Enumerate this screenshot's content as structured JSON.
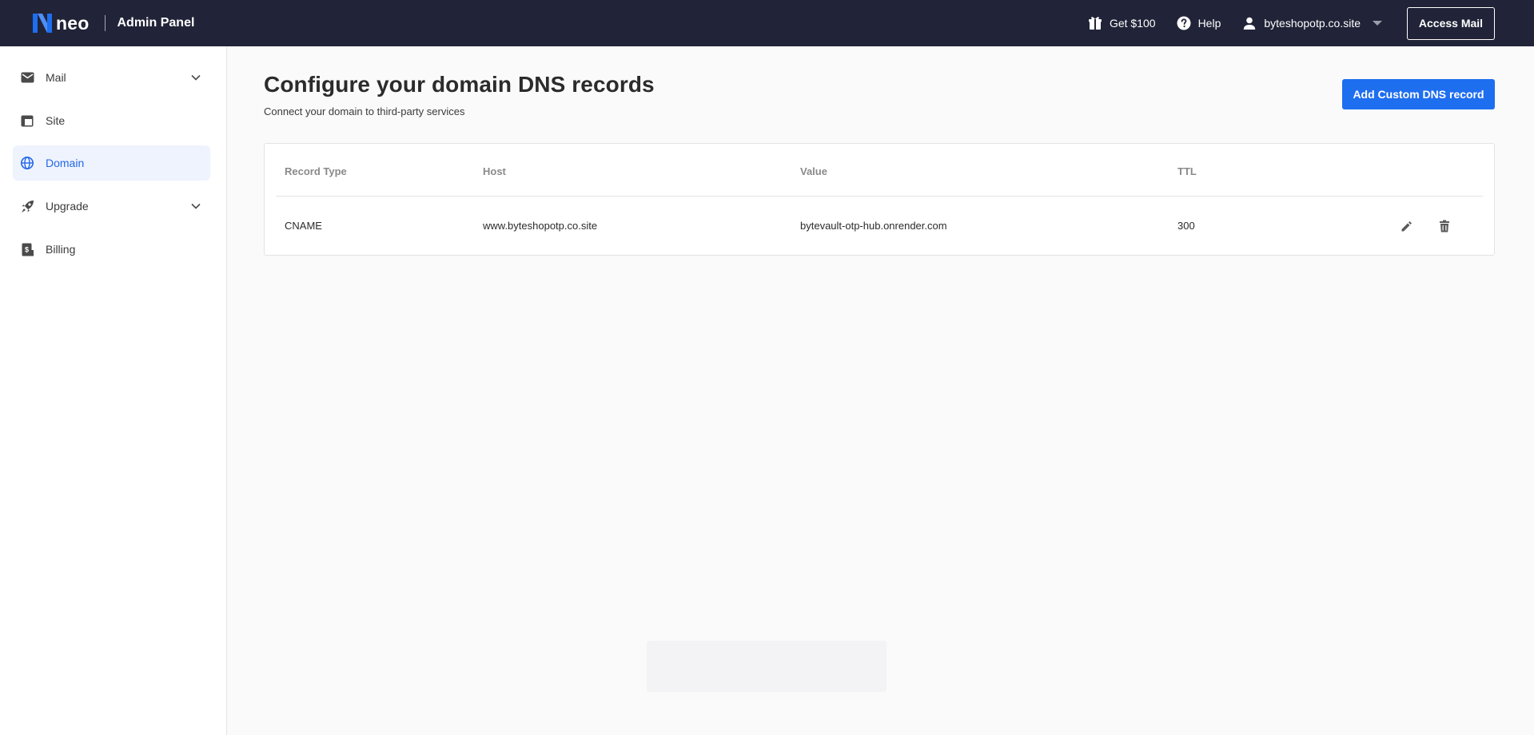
{
  "header": {
    "logo_text": "neo",
    "title": "Admin Panel",
    "gift_label": "Get $100",
    "help_label": "Help",
    "account_label": "byteshopotp.co.site",
    "access_mail_label": "Access Mail",
    "colors": {
      "bar_bg": "#212338",
      "logo_blue": "#1e6ef0"
    },
    "icons": [
      "gift-icon",
      "help-icon",
      "user-icon",
      "caret-down-icon"
    ]
  },
  "sidebar": {
    "items": [
      {
        "label": "Mail",
        "icon": "mail-icon",
        "has_chevron": true,
        "active": false
      },
      {
        "label": "Site",
        "icon": "site-icon",
        "has_chevron": false,
        "active": false
      },
      {
        "label": "Domain",
        "icon": "globe-icon",
        "has_chevron": false,
        "active": true
      },
      {
        "label": "Upgrade",
        "icon": "rocket-icon",
        "has_chevron": true,
        "active": false
      },
      {
        "label": "Billing",
        "icon": "billing-icon",
        "has_chevron": false,
        "active": false
      }
    ],
    "active_color": "#2466e8"
  },
  "main": {
    "title": "Configure your domain DNS records",
    "subtitle": "Connect your domain to third-party services",
    "add_button_label": "Add Custom DNS record",
    "table": {
      "columns": [
        "Record Type",
        "Host",
        "Value",
        "TTL"
      ],
      "rows": [
        {
          "type": "CNAME",
          "host": "www.byteshopotp.co.site",
          "value": "bytevault-otp-hub.onrender.com",
          "ttl": "300"
        }
      ],
      "row_actions": [
        "edit-icon",
        "delete-icon"
      ]
    }
  }
}
